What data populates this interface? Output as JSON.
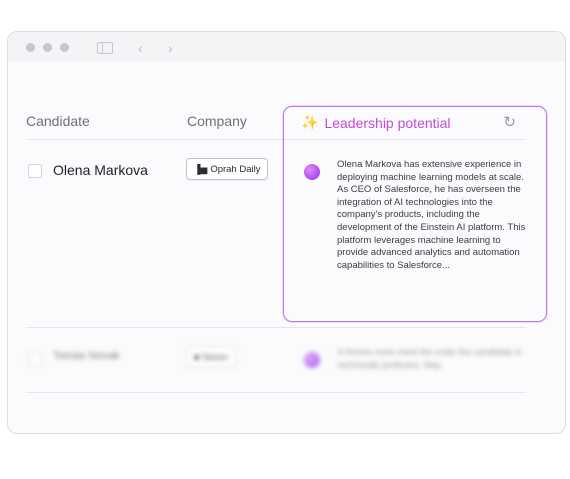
{
  "table": {
    "headers": {
      "candidate": "Candidate",
      "company": "Company",
      "leadership": "Leadership potential"
    },
    "rows": [
      {
        "name": "Olena Markova",
        "company": "Oprah Daily",
        "leadership_text": "Olena Markova has extensive experience in deploying machine learning models at scale. As CEO of Salesforce, he has overseen the integration of AI technologies into the company's products, including the development of the Einstein AI platform. This platform leverages machine learning to provide advanced analytics and automation capabilities to Salesforce..."
      },
      {
        "name": "Tomás Novak",
        "company": "Noom",
        "leadership_text": "It thrives more meet the order the candidate is technically proficient. May"
      }
    ]
  },
  "colors": {
    "accent_purple": "#b27cf0",
    "accent_pink": "#c34ad8",
    "orb": "#a64cf0"
  },
  "icons": {
    "header_sparkle": "sparkle-icon",
    "header_refresh": "refresh-icon",
    "chip_logo": "bar-chart-icon"
  }
}
